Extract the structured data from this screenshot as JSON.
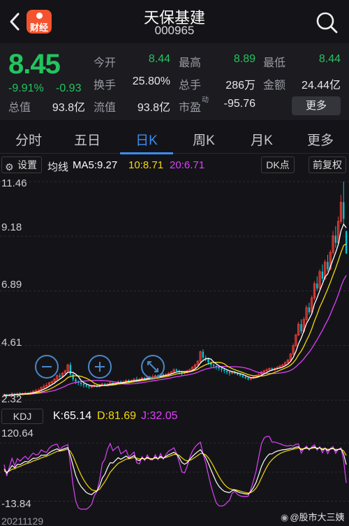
{
  "header": {
    "app_badge": "财经",
    "stock_name": "天保基建",
    "stock_code": "000965"
  },
  "quote": {
    "price": "8.45",
    "change_pct": "-9.91%",
    "change": "-0.93",
    "stats": [
      {
        "label": "今开",
        "value": "8.44",
        "green": true
      },
      {
        "label": "最高",
        "value": "8.89",
        "green": true
      },
      {
        "label": "最低",
        "value": "8.44",
        "green": true
      },
      {
        "label": "换手",
        "value": "25.80%",
        "green": false
      },
      {
        "label": "总手",
        "value": "286万",
        "green": false
      },
      {
        "label": "金额",
        "value": "24.44亿",
        "green": false
      },
      {
        "label": "总值",
        "value": "93.8亿",
        "green": false
      },
      {
        "label": "流值",
        "value": "93.8亿",
        "green": false
      },
      {
        "label": "市盈",
        "value": "-95.76",
        "green": false
      }
    ],
    "pe_superscript": "动",
    "more_label": "更多"
  },
  "tabs": [
    "分时",
    "五日",
    "日K",
    "周K",
    "月K",
    "更多"
  ],
  "active_tab": "日K",
  "toolbar": {
    "settings_label": "设置",
    "ma_title": "均线",
    "ma5": "MA5:9.27",
    "ma10": "10:8.71",
    "ma20": "20:6.71",
    "dk_label": "DK点",
    "adjust_label": "前复权"
  },
  "colors": {
    "ma5": "#ffffff",
    "ma10": "#f5d90a",
    "ma20": "#e040fb",
    "up": "#e53935",
    "down": "#00c8d7",
    "accent": "#3b8df5"
  },
  "price_axis": [
    "11.46",
    "9.18",
    "6.89",
    "4.61",
    "2.32"
  ],
  "kdj": {
    "label": "KDJ",
    "k": "K:65.14",
    "d": "D:81.69",
    "j": "J:32.05",
    "axis_top": "120.64",
    "axis_bottom": "-13.84"
  },
  "date_label": "20211129",
  "chart_controls": [
    "zoom-out-icon",
    "zoom-in-icon",
    "fullscreen-icon"
  ],
  "watermark": "@股市大三姨",
  "chart_data": {
    "type": "candlestick",
    "y_range": [
      2.32,
      11.46
    ],
    "price_axis_ticks": [
      11.46,
      9.18,
      6.89,
      4.61,
      2.32
    ],
    "candles": [
      [
        2.5,
        2.55,
        2.45,
        2.6
      ],
      [
        2.55,
        2.5,
        2.45,
        2.6
      ],
      [
        2.5,
        2.55,
        2.48,
        2.6
      ],
      [
        2.55,
        2.6,
        2.5,
        2.65
      ],
      [
        2.6,
        2.55,
        2.5,
        2.62
      ],
      [
        2.55,
        2.6,
        2.5,
        2.65
      ],
      [
        2.6,
        2.58,
        2.52,
        2.66
      ],
      [
        2.58,
        2.6,
        2.52,
        2.64
      ],
      [
        2.6,
        2.62,
        2.55,
        2.68
      ],
      [
        2.62,
        2.6,
        2.55,
        2.66
      ],
      [
        2.6,
        2.65,
        2.55,
        2.7
      ],
      [
        2.65,
        2.7,
        2.6,
        2.75
      ],
      [
        2.7,
        2.72,
        2.65,
        2.8
      ],
      [
        2.72,
        2.75,
        2.68,
        2.82
      ],
      [
        2.75,
        2.85,
        2.7,
        2.9
      ],
      [
        2.85,
        2.9,
        2.8,
        3.0
      ],
      [
        2.9,
        2.95,
        2.85,
        3.05
      ],
      [
        2.95,
        3.05,
        2.9,
        3.1
      ],
      [
        3.05,
        3.1,
        2.95,
        3.15
      ],
      [
        3.1,
        3.2,
        3.0,
        3.25
      ],
      [
        3.2,
        3.35,
        3.1,
        3.4
      ],
      [
        3.35,
        3.3,
        3.2,
        3.45
      ],
      [
        3.3,
        3.45,
        3.25,
        3.5
      ],
      [
        3.45,
        3.55,
        3.4,
        3.6
      ],
      [
        3.55,
        3.8,
        3.5,
        3.85
      ],
      [
        3.8,
        3.4,
        3.3,
        3.9
      ],
      [
        3.4,
        3.2,
        3.1,
        3.45
      ],
      [
        3.2,
        3.1,
        3.0,
        3.25
      ],
      [
        3.1,
        3.05,
        2.95,
        3.15
      ],
      [
        3.05,
        3.0,
        2.9,
        3.1
      ],
      [
        3.0,
        2.95,
        2.85,
        3.05
      ],
      [
        2.95,
        2.9,
        2.85,
        3.0
      ],
      [
        2.9,
        2.88,
        2.8,
        2.95
      ],
      [
        2.88,
        2.9,
        2.82,
        2.95
      ],
      [
        2.9,
        2.95,
        2.85,
        3.0
      ],
      [
        2.95,
        2.9,
        2.85,
        3.0
      ],
      [
        2.9,
        2.95,
        2.85,
        3.0
      ],
      [
        2.95,
        3.0,
        2.9,
        3.05
      ],
      [
        3.0,
        2.95,
        2.9,
        3.05
      ],
      [
        2.95,
        3.0,
        2.9,
        3.05
      ],
      [
        3.0,
        3.05,
        2.95,
        3.1
      ],
      [
        3.05,
        3.0,
        2.95,
        3.1
      ],
      [
        3.0,
        3.05,
        2.95,
        3.1
      ],
      [
        3.05,
        3.1,
        3.0,
        3.15
      ],
      [
        3.1,
        3.05,
        3.0,
        3.15
      ],
      [
        3.05,
        3.1,
        3.0,
        3.15
      ],
      [
        3.1,
        3.15,
        3.05,
        3.2
      ],
      [
        3.15,
        3.1,
        3.05,
        3.2
      ],
      [
        3.1,
        3.15,
        3.05,
        3.2
      ],
      [
        3.15,
        3.2,
        3.1,
        3.25
      ],
      [
        3.2,
        3.15,
        3.1,
        3.3
      ],
      [
        3.15,
        3.2,
        3.1,
        3.25
      ],
      [
        3.2,
        3.25,
        3.15,
        3.3
      ],
      [
        3.25,
        3.2,
        3.15,
        3.3
      ],
      [
        3.2,
        3.3,
        3.15,
        3.35
      ],
      [
        3.3,
        3.25,
        3.2,
        3.35
      ],
      [
        3.25,
        3.3,
        3.2,
        3.4
      ],
      [
        3.3,
        3.35,
        3.25,
        3.4
      ],
      [
        3.35,
        3.3,
        3.25,
        3.4
      ],
      [
        3.3,
        3.4,
        3.25,
        3.45
      ],
      [
        3.4,
        3.35,
        3.3,
        3.45
      ],
      [
        3.35,
        3.4,
        3.3,
        3.45
      ],
      [
        3.4,
        3.45,
        3.35,
        3.5
      ],
      [
        3.45,
        3.5,
        3.4,
        3.55
      ],
      [
        3.5,
        3.6,
        3.45,
        3.65
      ],
      [
        3.6,
        3.55,
        3.5,
        3.65
      ],
      [
        3.55,
        3.5,
        3.4,
        3.6
      ],
      [
        3.5,
        3.45,
        3.35,
        3.55
      ],
      [
        3.45,
        3.5,
        3.4,
        3.55
      ],
      [
        3.5,
        3.55,
        3.45,
        3.6
      ],
      [
        3.55,
        3.6,
        3.5,
        3.65
      ],
      [
        3.6,
        3.7,
        3.55,
        3.75
      ],
      [
        3.7,
        3.8,
        3.65,
        3.85
      ],
      [
        3.8,
        3.95,
        3.75,
        4.0
      ],
      [
        3.95,
        4.35,
        3.9,
        4.4
      ],
      [
        4.35,
        4.1,
        4.0,
        4.45
      ],
      [
        4.1,
        4.05,
        3.95,
        4.2
      ],
      [
        4.05,
        3.9,
        3.8,
        4.1
      ],
      [
        3.9,
        3.8,
        3.7,
        3.95
      ],
      [
        3.8,
        3.75,
        3.65,
        3.85
      ],
      [
        3.75,
        3.7,
        3.6,
        3.8
      ],
      [
        3.7,
        3.65,
        3.55,
        3.75
      ],
      [
        3.65,
        3.6,
        3.5,
        3.7
      ],
      [
        3.6,
        3.55,
        3.45,
        3.65
      ],
      [
        3.55,
        3.5,
        3.4,
        3.6
      ],
      [
        3.5,
        3.45,
        3.35,
        3.55
      ],
      [
        3.45,
        3.5,
        3.4,
        3.55
      ],
      [
        3.5,
        3.45,
        3.4,
        3.55
      ],
      [
        3.45,
        3.4,
        3.35,
        3.5
      ],
      [
        3.4,
        3.35,
        3.3,
        3.45
      ],
      [
        3.35,
        3.3,
        3.25,
        3.4
      ],
      [
        3.3,
        3.25,
        3.2,
        3.35
      ],
      [
        3.25,
        3.2,
        3.15,
        3.3
      ],
      [
        3.2,
        3.25,
        3.15,
        3.3
      ],
      [
        3.25,
        3.3,
        3.2,
        3.35
      ],
      [
        3.3,
        3.35,
        3.25,
        3.4
      ],
      [
        3.35,
        3.4,
        3.3,
        3.45
      ],
      [
        3.4,
        3.5,
        3.35,
        3.55
      ],
      [
        3.5,
        3.55,
        3.45,
        3.6
      ],
      [
        3.55,
        3.6,
        3.5,
        3.65
      ],
      [
        3.6,
        3.65,
        3.55,
        3.7
      ],
      [
        3.65,
        3.6,
        3.55,
        3.7
      ],
      [
        3.6,
        3.65,
        3.55,
        3.7
      ],
      [
        3.65,
        3.7,
        3.6,
        3.75
      ],
      [
        3.7,
        3.75,
        3.65,
        3.8
      ],
      [
        3.75,
        3.8,
        3.7,
        3.85
      ],
      [
        3.8,
        3.9,
        3.75,
        3.95
      ],
      [
        3.9,
        4.0,
        3.85,
        4.05
      ],
      [
        4.0,
        4.25,
        3.95,
        4.3
      ],
      [
        4.25,
        4.6,
        4.2,
        4.7
      ],
      [
        4.6,
        5.05,
        4.55,
        5.1
      ],
      [
        5.05,
        5.5,
        5.0,
        5.6
      ],
      [
        5.5,
        5.2,
        5.1,
        5.7
      ],
      [
        5.2,
        5.7,
        5.15,
        5.8
      ],
      [
        5.7,
        6.2,
        5.6,
        6.3
      ],
      [
        6.2,
        6.0,
        5.9,
        6.4
      ],
      [
        6.0,
        6.6,
        5.95,
        6.7
      ],
      [
        6.6,
        7.2,
        6.5,
        7.3
      ],
      [
        7.2,
        7.0,
        6.9,
        7.5
      ],
      [
        7.0,
        7.7,
        6.95,
        7.8
      ],
      [
        7.7,
        7.4,
        7.3,
        8.0
      ],
      [
        7.4,
        8.1,
        7.35,
        8.2
      ],
      [
        8.1,
        7.8,
        7.7,
        8.4
      ],
      [
        7.8,
        8.5,
        7.75,
        8.6
      ],
      [
        8.5,
        9.2,
        8.4,
        9.4
      ],
      [
        9.2,
        8.9,
        8.7,
        9.6
      ],
      [
        8.9,
        9.8,
        8.85,
        10.0
      ],
      [
        9.8,
        10.6,
        9.7,
        10.9
      ],
      [
        10.6,
        9.9,
        9.7,
        11.46
      ],
      [
        9.4,
        8.45,
        8.44,
        8.89
      ]
    ],
    "ma5_last": 9.27,
    "ma10_last": 8.71,
    "ma20_last": 6.71,
    "kdj_range": [
      -13.84,
      120.64
    ],
    "kdj_last": {
      "K": 65.14,
      "D": 81.69,
      "J": 32.05
    }
  }
}
